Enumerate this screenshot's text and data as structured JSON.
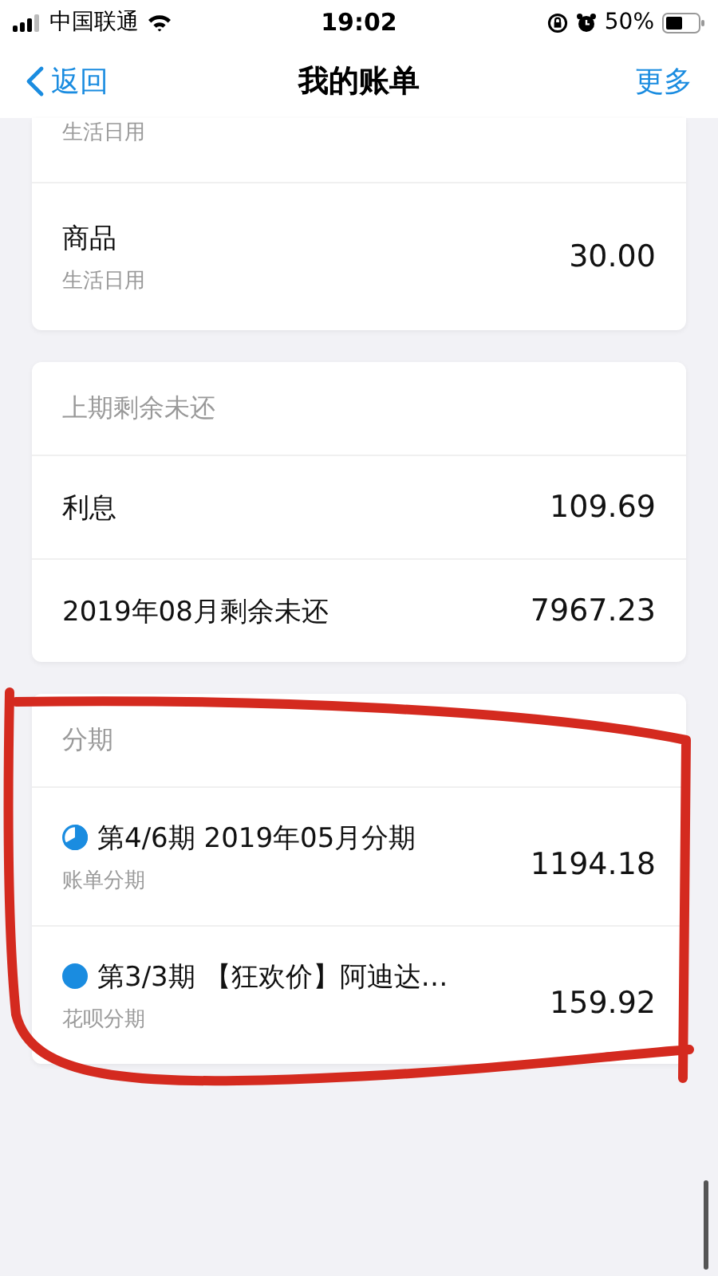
{
  "status_bar": {
    "carrier": "中国联通",
    "time": "19:02",
    "battery": "50%"
  },
  "nav": {
    "back": "返回",
    "title": "我的账单",
    "more": "更多"
  },
  "cards": [
    {
      "rows": [
        {
          "subtitle": "生活日用"
        },
        {
          "title": "商品",
          "subtitle": "生活日用",
          "amount": "30.00"
        }
      ]
    },
    {
      "header": "上期剩余未还",
      "rows": [
        {
          "title": "利息",
          "amount": "109.69"
        },
        {
          "title": "2019年08月剩余未还",
          "amount": "7967.23"
        }
      ]
    },
    {
      "header": "分期",
      "rows": [
        {
          "title": "第4/6期 2019年05月分期",
          "subtitle": "账单分期",
          "amount": "1194.18",
          "completed": false
        },
        {
          "title": "第3/3期 【狂欢价】阿迪达…",
          "subtitle": "花呗分期",
          "amount": "159.92",
          "completed": true
        }
      ]
    }
  ]
}
